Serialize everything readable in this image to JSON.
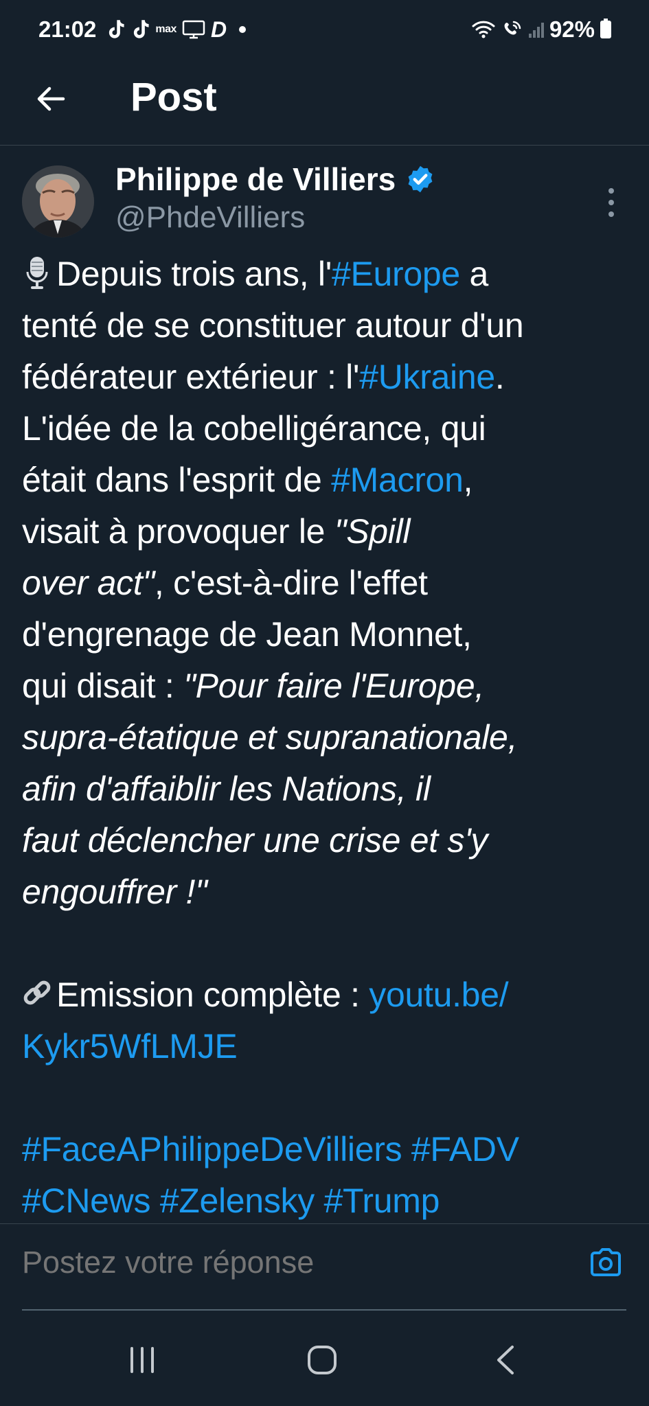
{
  "status_bar": {
    "time": "21:02",
    "small_label": "max",
    "d_glyph": "D",
    "battery": "92%",
    "icons": [
      "tiktok-icon",
      "tiktok-icon",
      "max-icon",
      "monitor-icon",
      "d-icon",
      "dot-icon",
      "wifi-icon",
      "wifi-call-icon",
      "signal-icon",
      "battery-icon"
    ]
  },
  "header": {
    "title": "Post"
  },
  "post": {
    "author_name": "Philippe de Villiers",
    "author_handle": "@PhdeVilliers",
    "body": {
      "l1a": "Depuis trois ans, l'",
      "l1tag": "#Europe",
      "l1b": " a",
      "l2": "tenté de se constituer autour d'un",
      "l3a": "fédérateur extérieur : l'",
      "l3tag": "#Ukraine",
      "l3b": ".",
      "l4": "L'idée de la cobelligérance, qui",
      "l5a": "était dans l'esprit de ",
      "l5tag": "#Macron",
      "l5b": ",",
      "l6a": "visait à provoquer le ",
      "l6i": "\"Spill",
      "l7i": "over act\"",
      "l7b": ", c'est-à-dire l'effet",
      "l8": "d'engrenage de Jean Monnet,",
      "l9a": "qui disait : ",
      "l9i": "\"Pour faire l'Europe,",
      "l10i": "supra-étatique et supranationale,",
      "l11i": "afin d'affaiblir les Nations, il",
      "l12i": "faut déclencher une crise et s'y",
      "l13i": "engouffrer !\"",
      "l15a": "Emission complète : ",
      "l15link": "youtu.be/",
      "l16link": "Kykr5WfLMJE",
      "l18tag1": "#FaceAPhilippeDeVilliers",
      "l18tag2": "#FADV",
      "l19tag1": "#CNews",
      "l19tag2": "#Zelensky",
      "l19tag3": "#Trump"
    }
  },
  "reply": {
    "placeholder": "Postez votre réponse"
  },
  "colors": {
    "background": "#15202b",
    "accent": "#1d9bf0",
    "secondary_text": "#8b98a5",
    "divider": "#38444d"
  }
}
